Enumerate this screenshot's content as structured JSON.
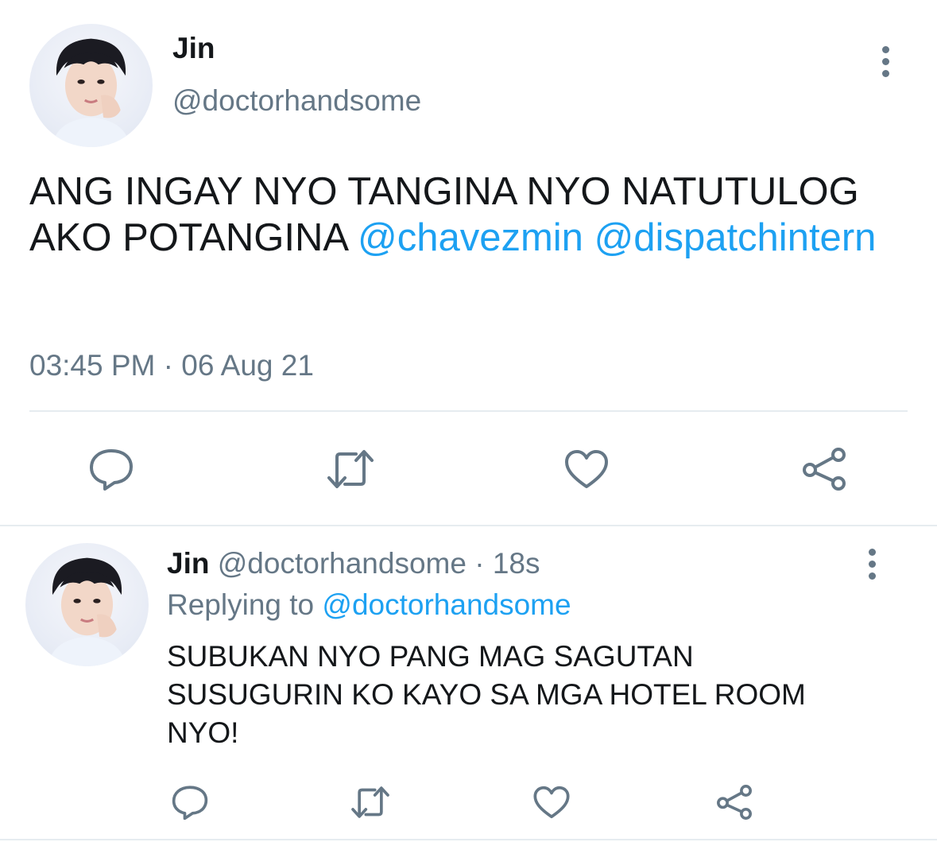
{
  "tweet": {
    "author_name": "Jin",
    "author_handle": "@doctorhandsome",
    "text": "ANG INGAY NYO TANGINA NYO NATUTULOG AKO POTANGINA",
    "mentions": [
      "@chavezmin",
      "@dispatchintern"
    ],
    "timestamp": "03:45 PM · 06 Aug 21",
    "actions": [
      "reply-icon",
      "retweet-icon",
      "like-icon",
      "share-icon"
    ]
  },
  "reply": {
    "author_name": "Jin",
    "author_handle": "@doctorhandsome",
    "age": "· 18s",
    "replying_to_label": "Replying to",
    "replying_to_handle": "@doctorhandsome",
    "text_lines": [
      "SUBUKAN NYO PANG MAG SAGUTAN",
      "SUSUGURIN KO KAYO SA MGA HOTEL ROOM",
      "NYO!"
    ],
    "actions": [
      "reply-icon",
      "retweet-icon",
      "like-icon",
      "share-icon"
    ]
  },
  "colors": {
    "text": "#14171a",
    "secondary": "#657786",
    "link": "#1da1f2",
    "divider": "#e6ecf0"
  }
}
